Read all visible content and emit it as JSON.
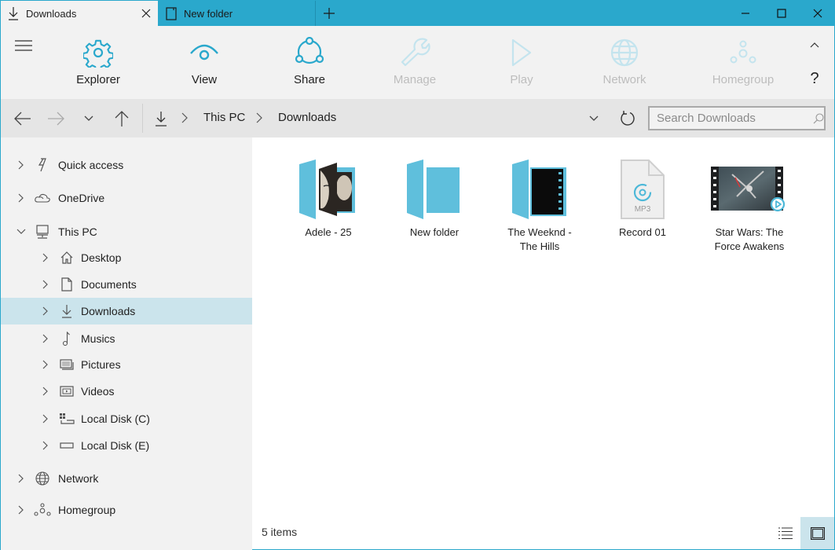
{
  "titlebar": {
    "tabs": [
      {
        "label": "Downloads",
        "icon": "download-icon",
        "active": true
      },
      {
        "label": "New folder",
        "icon": "document-icon",
        "active": false
      }
    ],
    "new_tab": "+",
    "window_controls": [
      "minimize",
      "maximize",
      "close"
    ]
  },
  "ribbon": {
    "buttons": [
      {
        "label": "Explorer",
        "icon": "gear-icon",
        "enabled": true
      },
      {
        "label": "View",
        "icon": "eye-icon",
        "enabled": true
      },
      {
        "label": "Share",
        "icon": "share-icon",
        "enabled": true
      },
      {
        "label": "Manage",
        "icon": "wrench-icon",
        "enabled": false
      },
      {
        "label": "Play",
        "icon": "play-icon",
        "enabled": false
      },
      {
        "label": "Network",
        "icon": "globe-icon",
        "enabled": false
      },
      {
        "label": "Homegroup",
        "icon": "homegroup-icon",
        "enabled": false
      }
    ],
    "help": "?"
  },
  "addressbar": {
    "breadcrumb": [
      "This PC",
      "Downloads"
    ],
    "search_placeholder": "Search Downloads"
  },
  "sidebar": {
    "items": [
      {
        "label": "Quick access",
        "icon": "lightning-icon",
        "level": 0,
        "expanded": false
      },
      {
        "label": "OneDrive",
        "icon": "cloud-icon",
        "level": 0,
        "expanded": false
      },
      {
        "label": "This PC",
        "icon": "computer-icon",
        "level": 0,
        "expanded": true
      },
      {
        "label": "Desktop",
        "icon": "home-icon",
        "level": 1,
        "expanded": false
      },
      {
        "label": "Documents",
        "icon": "document-icon",
        "level": 1,
        "expanded": false
      },
      {
        "label": "Downloads",
        "icon": "download-icon",
        "level": 1,
        "expanded": false,
        "selected": true
      },
      {
        "label": "Musics",
        "icon": "music-note-icon",
        "level": 1,
        "expanded": false
      },
      {
        "label": "Pictures",
        "icon": "pictures-icon",
        "level": 1,
        "expanded": false
      },
      {
        "label": "Videos",
        "icon": "video-icon",
        "level": 1,
        "expanded": false
      },
      {
        "label": "Local Disk (C)",
        "icon": "system-disk-icon",
        "level": 1,
        "expanded": false
      },
      {
        "label": "Local Disk (E)",
        "icon": "disk-icon",
        "level": 1,
        "expanded": false
      },
      {
        "label": "Network",
        "icon": "globe-icon",
        "level": 0,
        "expanded": false
      },
      {
        "label": "Homegroup",
        "icon": "homegroup-icon",
        "level": 0,
        "expanded": false
      }
    ]
  },
  "files": [
    {
      "name": "Adele - 25",
      "type": "folder-with-album-art"
    },
    {
      "name": "New folder",
      "type": "folder"
    },
    {
      "name": "The Weeknd - The Hills",
      "type": "folder-with-video"
    },
    {
      "name": "Record 01",
      "type": "mp3",
      "badge": "MP3"
    },
    {
      "name": "Star Wars: The Force Awakens",
      "type": "video"
    }
  ],
  "file_labels": [
    [
      "Adele - 25"
    ],
    [
      "New folder"
    ],
    [
      "The Weeknd -",
      "The Hills"
    ],
    [
      "Record 01"
    ],
    [
      "Star Wars: The",
      "Force Awakens"
    ]
  ],
  "statusbar": {
    "item_count": "5 items",
    "active_view": "tiles"
  },
  "colors": {
    "accent": "#2aa8cc",
    "folder": "#5fbfdc",
    "selection": "#cbe4ec",
    "disabled_icon": "#c4e4ee",
    "disabled_text": "#bdbdbd"
  }
}
